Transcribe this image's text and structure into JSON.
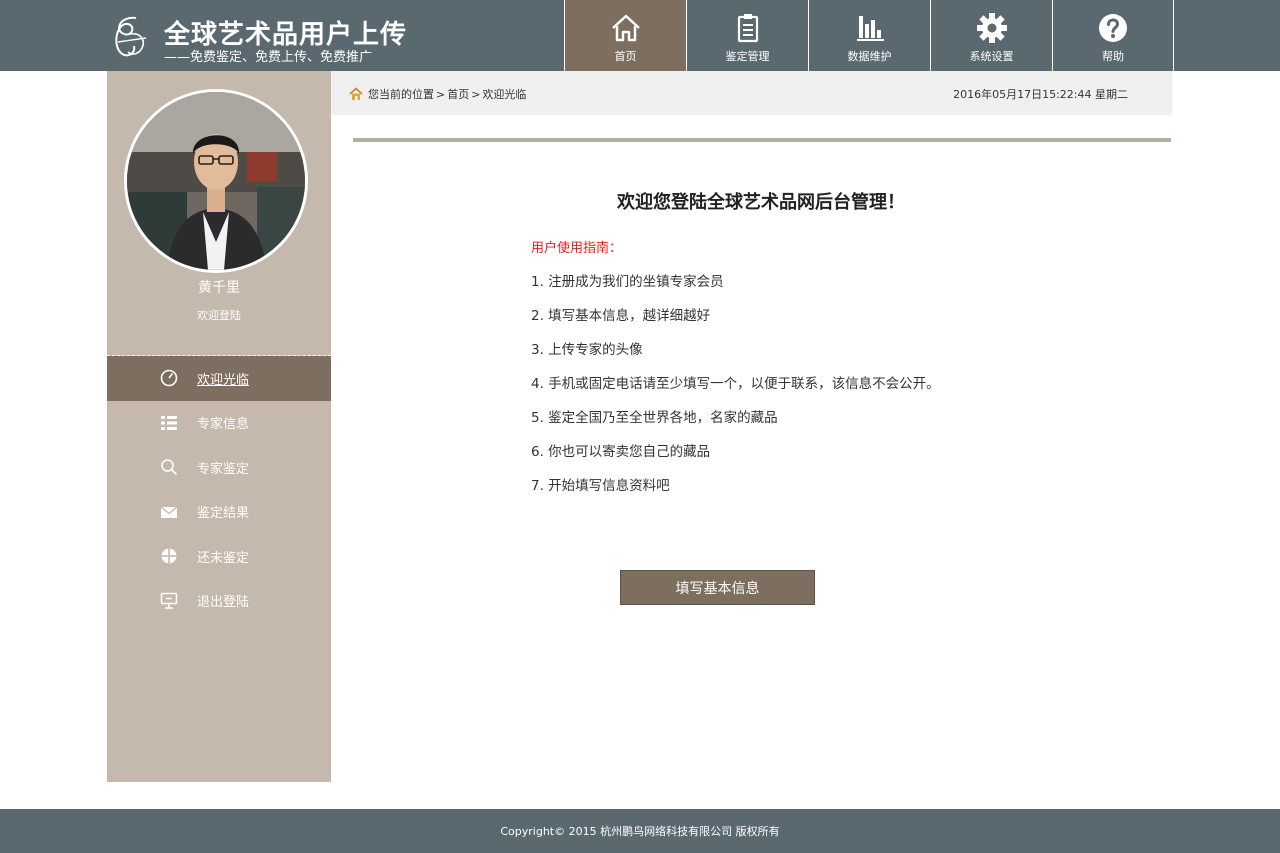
{
  "header": {
    "logo_title": "全球艺术品用户上传",
    "logo_subtitle": "——免费鉴定、免费上传、免费推广",
    "nav": [
      {
        "label": "首页",
        "icon": "home-icon",
        "active": true
      },
      {
        "label": "鉴定管理",
        "icon": "clipboard-icon",
        "active": false
      },
      {
        "label": "数据维护",
        "icon": "bar-chart-icon",
        "active": false
      },
      {
        "label": "系统设置",
        "icon": "gear-icon",
        "active": false
      },
      {
        "label": "帮助",
        "icon": "help-icon",
        "active": false
      }
    ]
  },
  "sidebar": {
    "user_name": "黄千里",
    "user_status": "欢迎登陆",
    "menu": [
      {
        "label": "欢迎光临",
        "icon": "dashboard-icon",
        "active": true
      },
      {
        "label": "专家信息",
        "icon": "list-icon",
        "active": false
      },
      {
        "label": "专家鉴定",
        "icon": "search-icon",
        "active": false
      },
      {
        "label": "鉴定结果",
        "icon": "mail-icon",
        "active": false
      },
      {
        "label": "还未鉴定",
        "icon": "pie-icon",
        "active": false
      },
      {
        "label": "退出登陆",
        "icon": "logout-icon",
        "active": false
      }
    ]
  },
  "breadcrumb": {
    "prefix": "您当前的位置",
    "home": "首页",
    "current": "欢迎光临",
    "separator": ">"
  },
  "datetime": "2016年05月17日15:22:44 星期二",
  "main": {
    "welcome": "欢迎您登陆全球艺术品网后台管理！",
    "guide_title": "用户使用指南：",
    "guide_items": [
      "1. 注册成为我们的坐镇专家会员",
      "2. 填写基本信息，越详细越好",
      "3. 上传专家的头像",
      "4. 手机或固定电话请至少填写一个，以便于联系，该信息不会公开。",
      "5. 鉴定全国乃至全世界各地，名家的藏品",
      "6. 你也可以寄卖您自己的藏品",
      "7. 开始填写信息资料吧"
    ],
    "button_label": "填写基本信息"
  },
  "footer": {
    "copyright": "Copyright© 2015 杭州鹏鸟网络科技有限公司 版权所有"
  },
  "colors": {
    "header_bg": "#5a6970",
    "accent": "#7d6e5f",
    "sidebar_bg": "#c4b9ac",
    "guide_title": "#e0201f"
  }
}
